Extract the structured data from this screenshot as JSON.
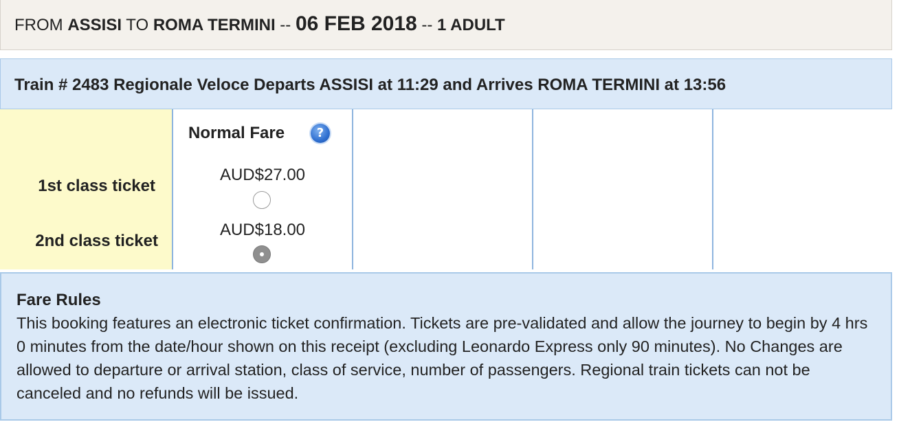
{
  "search": {
    "from_label": "FROM",
    "origin": "ASSISI",
    "to_label": "TO",
    "destination": "ROMA TERMINI",
    "sep1": "--",
    "date": "06 FEB 2018",
    "sep2": "--",
    "passengers": "1 ADULT"
  },
  "train": {
    "description": "Train # 2483 Regionale Veloce Departs  ASSISI at  11:29 and Arrives  ROMA TERMINI at  13:56"
  },
  "classes": {
    "first": "1st class ticket",
    "second": "2nd class ticket"
  },
  "fares": {
    "normal_header": "Normal Fare",
    "help_icon": "help-icon",
    "help_glyph": "?",
    "first_price": "AUD$27.00",
    "second_price": "AUD$18.00",
    "selected": "second"
  },
  "fare_rules": {
    "title": "Fare Rules",
    "text": "This booking features an electronic ticket confirmation. Tickets are pre-validated and allow the journey to begin by 4 hrs 0 minutes from the date/hour shown on this receipt (excluding Leonardo Express only 90 minutes). No Changes are allowed to departure or arrival station, class of service, number of passengers. Regional train tickets can not be canceled and no refunds will be issued."
  },
  "colors": {
    "header_bg": "#f4f1ec",
    "train_bar_bg": "#dbe9f8",
    "class_col_bg": "#fdfacb",
    "border_blue": "#8db4de"
  }
}
